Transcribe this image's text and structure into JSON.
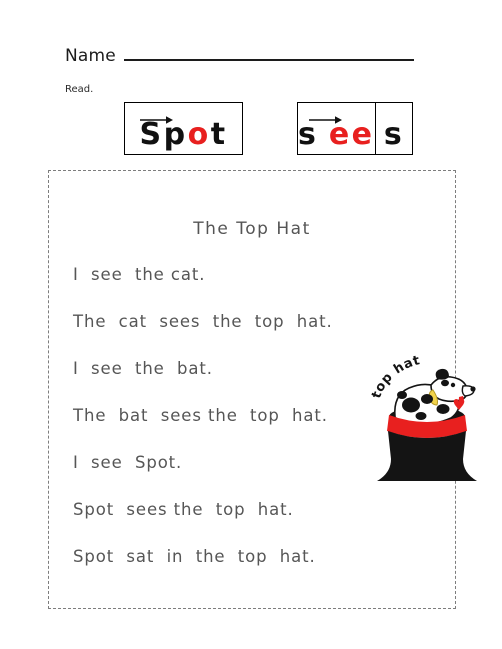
{
  "header": {
    "name_label": "Name",
    "name_value": "",
    "read_instruction": "Read."
  },
  "word_boxes": [
    {
      "id": "spot",
      "arrow_icon": "blend-arrow-right",
      "segments": [
        {
          "text": "S",
          "color": "#111111"
        },
        {
          "text": "p",
          "color": "#111111"
        },
        {
          "text": "o",
          "color": "#e8201f"
        },
        {
          "text": "t",
          "color": "#111111"
        }
      ],
      "full_word": "Spot",
      "highlight_color": "#e8201f",
      "cells": 1
    },
    {
      "id": "sees",
      "arrow_icon": "blend-arrow-right",
      "segments": [
        {
          "text": "s",
          "color": "#111111"
        },
        {
          "text": "ee",
          "color": "#e8201f"
        }
      ],
      "tail": {
        "text": "s",
        "color": "#111111"
      },
      "full_word": "sees",
      "highlight_color": "#e8201f",
      "cells": 2
    }
  ],
  "story": {
    "title": "The Top Hat",
    "lines": [
      "I  see  the cat.",
      "The  cat  sees  the  top  hat.",
      "I  see  the  bat.",
      "The  bat  sees the  top  hat.",
      "I  see  Spot.",
      "Spot  sees the  top  hat.",
      "Spot  sat  in  the  top  hat."
    ]
  },
  "illustration": {
    "label": "top hat",
    "alt_name": "dalmatian-dog-in-top-hat",
    "colors": {
      "hat_body": "#141414",
      "hat_band": "#e8201f",
      "dog_body": "#ffffff",
      "dog_spots": "#141414",
      "collar": "#f2d34a",
      "tongue": "#e8201f",
      "heart": "#e8201f"
    }
  }
}
